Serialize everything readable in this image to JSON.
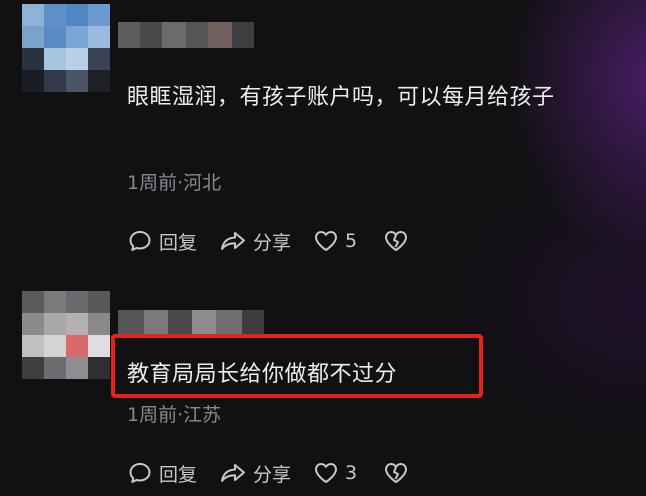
{
  "comments": [
    {
      "text": "眼眶湿润，有孩子账户吗，可以每月给孩子",
      "meta": "1周前·河北",
      "actions": {
        "reply": "回复",
        "share": "分享",
        "likes": "5"
      }
    },
    {
      "text": "教育局局长给你做都不过分",
      "meta": "1周前·江苏",
      "actions": {
        "reply": "回复",
        "share": "分享",
        "likes": "3"
      }
    }
  ],
  "icons": {
    "reply": "comment-bubble-icon",
    "share": "share-arrow-icon",
    "like": "heart-icon",
    "dislike": "broken-heart-icon"
  },
  "colors": {
    "background": "#111013",
    "text": "#ededf0",
    "meta": "#8a878e",
    "icon": "#c9c7cc",
    "highlight_border": "#e3241d",
    "glow": "#7828aa"
  }
}
